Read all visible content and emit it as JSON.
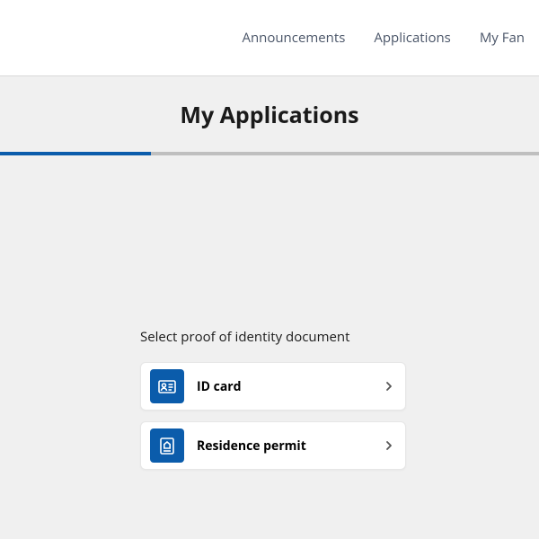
{
  "nav": {
    "items": [
      {
        "label": "Announcements"
      },
      {
        "label": "Applications"
      },
      {
        "label": "My Fan"
      }
    ]
  },
  "page": {
    "title": "My Applications"
  },
  "form": {
    "heading": "Select proof of identity document",
    "options": [
      {
        "label": "ID card",
        "icon": "id-card-icon"
      },
      {
        "label": "Residence permit",
        "icon": "house-doc-icon"
      }
    ]
  },
  "colors": {
    "accent": "#0b5cab"
  }
}
